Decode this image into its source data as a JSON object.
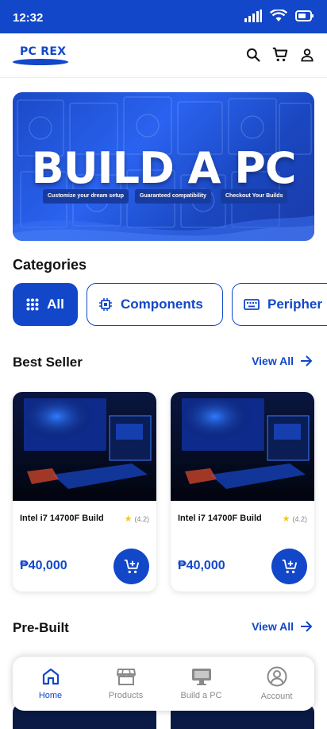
{
  "status_bar": {
    "time": "12:32"
  },
  "app_bar": {
    "logo_text": "PC REX",
    "actions": [
      "search-icon",
      "cart-icon",
      "account-icon"
    ]
  },
  "banner": {
    "title": "BUILD A PC",
    "pills": [
      "Customize your dream setup",
      "Guaranteed compatibility",
      "Checkout Your Builds"
    ]
  },
  "categories": {
    "title": "Categories",
    "items": [
      {
        "label": "All",
        "icon": "grid-icon",
        "active": true
      },
      {
        "label": "Components",
        "icon": "chip-icon",
        "active": false
      },
      {
        "label": "Peripher",
        "icon": "keyboard-icon",
        "active": false
      }
    ]
  },
  "best_seller": {
    "title": "Best Seller",
    "view_all": "View All",
    "products": [
      {
        "name": "Intel i7 14700F Build",
        "rating": "(4.2)",
        "price": "₱40,000"
      },
      {
        "name": "Intel i7 14700F Build",
        "rating": "(4.2)",
        "price": "₱40,000"
      }
    ]
  },
  "pre_built": {
    "title": "Pre-Built",
    "view_all": "View All"
  },
  "bottom_nav": {
    "items": [
      {
        "label": "Home",
        "icon": "home-icon",
        "active": true
      },
      {
        "label": "Products",
        "icon": "store-icon",
        "active": false
      },
      {
        "label": "Build a PC",
        "icon": "monitor-icon",
        "active": false
      },
      {
        "label": "Account",
        "icon": "account-circle-icon",
        "active": false
      }
    ]
  },
  "colors": {
    "primary": "#1247c9",
    "inactive": "#8a8a8a",
    "star": "#f5c518"
  }
}
